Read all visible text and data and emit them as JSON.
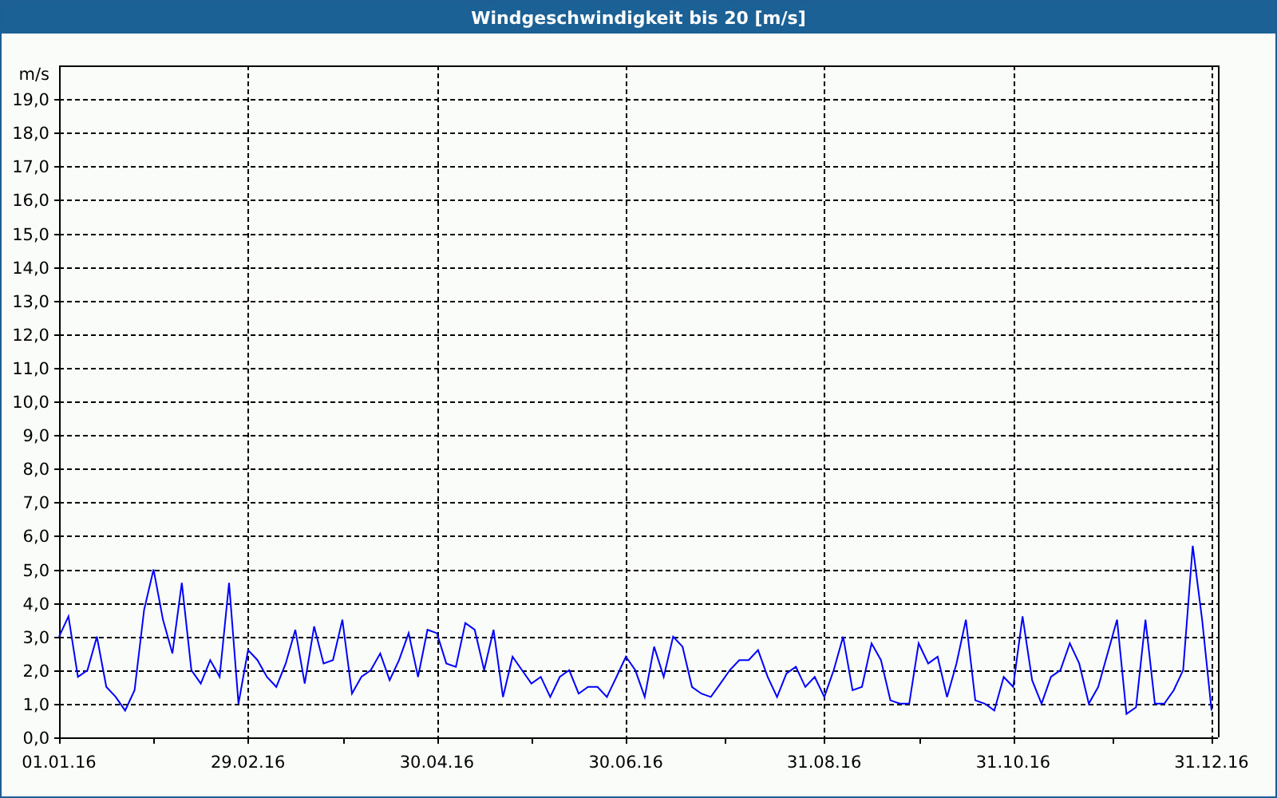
{
  "window": {
    "title": "Windgeschwindigkeit bis 20 [m/s]"
  },
  "chart": {
    "chart_data": {
      "type": "line",
      "grid": true,
      "ylabel": "m/s",
      "ylim": [
        0,
        20
      ],
      "categories": [
        "01.01.16",
        null,
        null,
        null,
        null,
        null,
        null,
        null,
        null,
        null,
        null,
        null,
        null,
        null,
        null,
        null,
        null,
        null,
        null,
        null,
        "29.02.16",
        null,
        null,
        null,
        null,
        null,
        null,
        null,
        null,
        null,
        null,
        null,
        null,
        null,
        null,
        null,
        null,
        null,
        null,
        null,
        "30.04.16",
        null,
        null,
        null,
        null,
        null,
        null,
        null,
        null,
        null,
        null,
        null,
        null,
        null,
        null,
        null,
        null,
        null,
        null,
        null,
        "30.06.16",
        null,
        null,
        null,
        null,
        null,
        null,
        null,
        null,
        null,
        null,
        null,
        null,
        null,
        null,
        null,
        null,
        null,
        null,
        null,
        null,
        "31.08.16",
        null,
        null,
        null,
        null,
        null,
        null,
        null,
        null,
        null,
        null,
        null,
        null,
        null,
        null,
        null,
        null,
        null,
        null,
        null,
        "31.10.16",
        null,
        null,
        null,
        null,
        null,
        null,
        null,
        null,
        null,
        null,
        null,
        null,
        null,
        null,
        null,
        null,
        null,
        null,
        null,
        null,
        "31.12.16"
      ],
      "series": [
        {
          "color": "#0000ff",
          "values": [
            3.0,
            3.6,
            1.8,
            2.0,
            3.0,
            1.5,
            1.2,
            0.8,
            1.4,
            3.8,
            5.0,
            3.5,
            2.5,
            4.6,
            2.0,
            1.6,
            2.3,
            1.8,
            4.6,
            1.0,
            2.6,
            2.3,
            1.8,
            1.5,
            2.2,
            3.2,
            1.6,
            3.3,
            2.2,
            2.3,
            3.5,
            1.3,
            1.8,
            2.0,
            2.5,
            1.7,
            2.3,
            3.1,
            1.8,
            3.2,
            3.1,
            2.2,
            2.1,
            3.4,
            3.2,
            2.0,
            3.2,
            1.2,
            2.4,
            2.0,
            1.6,
            1.8,
            1.2,
            1.8,
            2.0,
            1.3,
            1.5,
            1.5,
            1.2,
            1.8,
            2.4,
            2.0,
            1.2,
            2.7,
            1.8,
            3.0,
            2.7,
            1.5,
            1.3,
            1.2,
            1.6,
            2.0,
            2.3,
            2.3,
            2.6,
            1.8,
            1.2,
            1.9,
            2.1,
            1.5,
            1.8,
            1.2,
            2.0,
            3.0,
            1.4,
            1.5,
            2.8,
            2.3,
            1.1,
            1.0,
            1.0,
            2.8,
            2.2,
            2.4,
            1.2,
            2.2,
            3.5,
            1.1,
            1.0,
            0.8,
            1.8,
            1.5,
            3.6,
            1.7,
            1.0,
            1.8,
            2.0,
            2.8,
            2.2,
            1.0,
            1.5,
            2.5,
            3.5,
            0.7,
            0.9,
            3.5,
            1.0,
            1.0,
            1.4,
            2.0,
            5.7,
            3.5,
            0.8
          ]
        }
      ],
      "yticks": [
        {
          "value": 0,
          "label": "0,0"
        },
        {
          "value": 1,
          "label": "1,0"
        },
        {
          "value": 2,
          "label": "2,0"
        },
        {
          "value": 3,
          "label": "3,0"
        },
        {
          "value": 4,
          "label": "4,0"
        },
        {
          "value": 5,
          "label": "5,0"
        },
        {
          "value": 6,
          "label": "6,0"
        },
        {
          "value": 7,
          "label": "7,0"
        },
        {
          "value": 8,
          "label": "8,0"
        },
        {
          "value": 9,
          "label": "9,0"
        },
        {
          "value": 10,
          "label": "10,0"
        },
        {
          "value": 11,
          "label": "11,0"
        },
        {
          "value": 12,
          "label": "12,0"
        },
        {
          "value": 13,
          "label": "13,0"
        },
        {
          "value": 14,
          "label": "14,0"
        },
        {
          "value": 15,
          "label": "15,0"
        },
        {
          "value": 16,
          "label": "16,0"
        },
        {
          "value": 17,
          "label": "17,0"
        },
        {
          "value": 18,
          "label": "18,0"
        },
        {
          "value": 19,
          "label": "19,0"
        }
      ]
    }
  }
}
